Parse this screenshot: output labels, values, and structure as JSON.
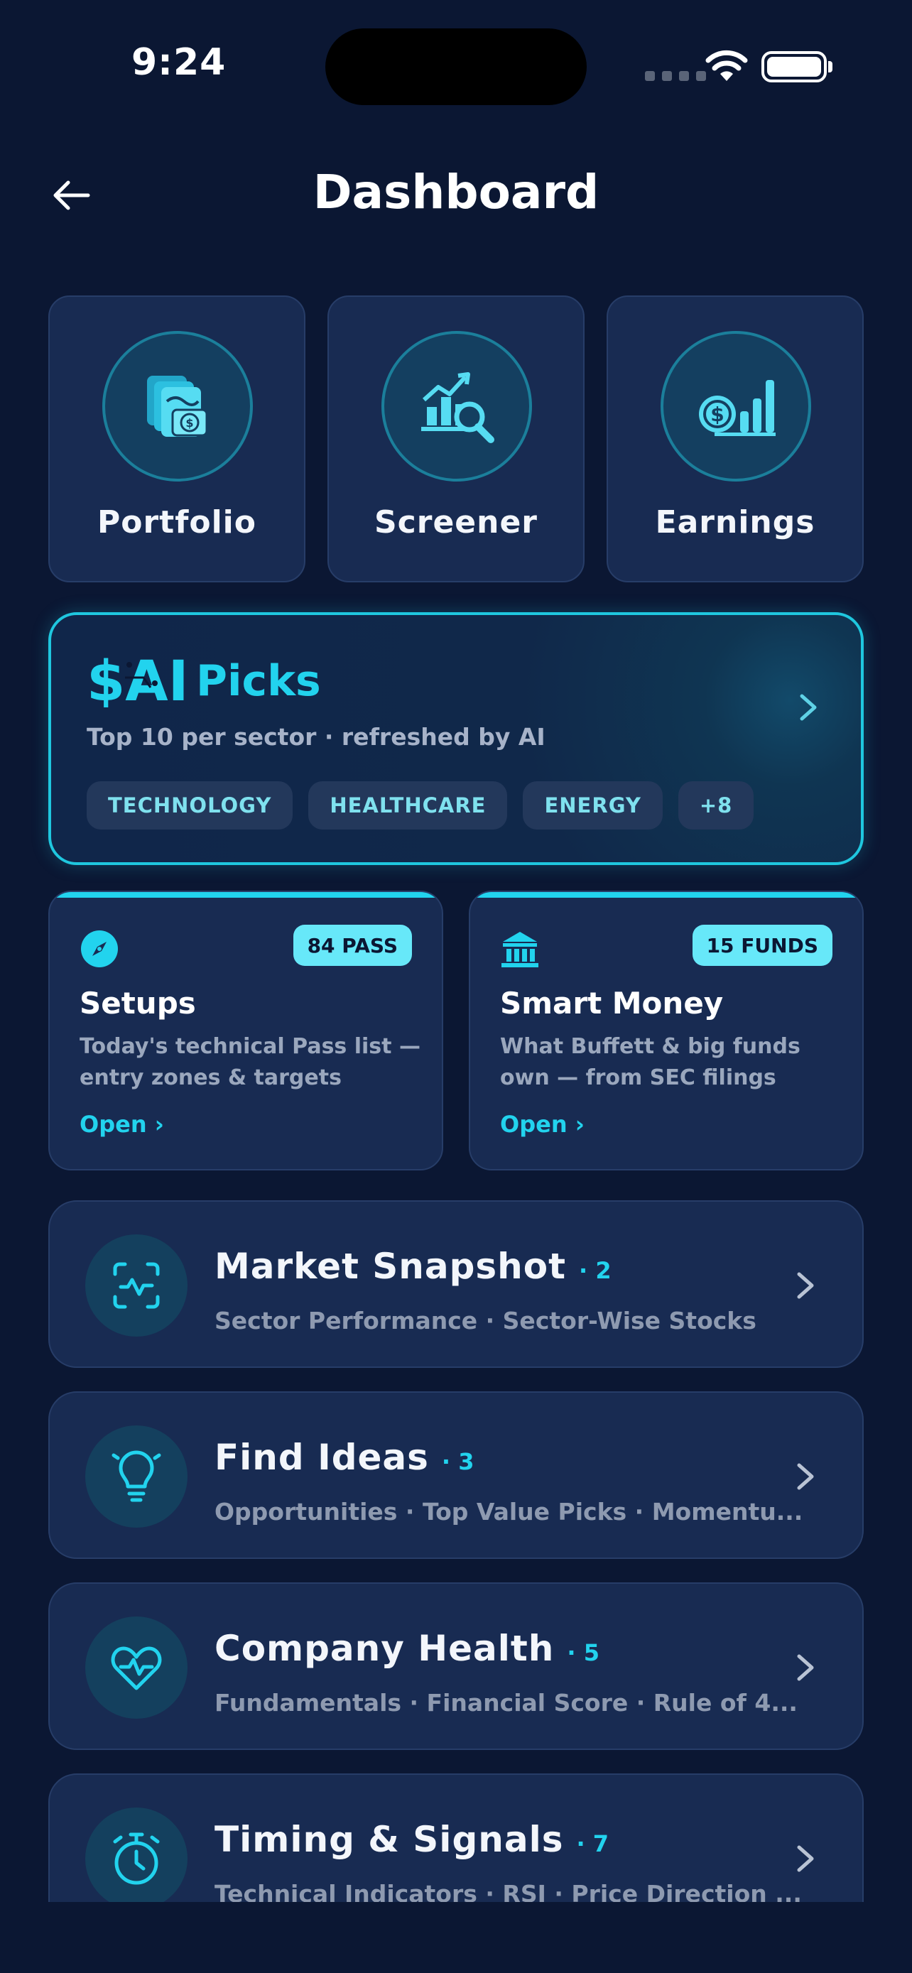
{
  "status_bar": {
    "time": "9:24"
  },
  "header": {
    "title": "Dashboard"
  },
  "tiles": [
    {
      "label": "Portfolio",
      "icon": "portfolio-cash-icon"
    },
    {
      "label": "Screener",
      "icon": "chart-search-icon"
    },
    {
      "label": "Earnings",
      "icon": "coin-bars-icon"
    }
  ],
  "ai_picks": {
    "logo_text": "$AI",
    "title": "Picks",
    "subtitle": "Top 10 per sector · refreshed by AI",
    "chips": [
      "TECHNOLOGY",
      "HEALTHCARE",
      "ENERGY",
      "+8"
    ]
  },
  "cards": [
    {
      "title": "Setups",
      "badge": "84 PASS",
      "description": "Today's technical Pass list — entry zones & targets",
      "link": "Open ›",
      "icon": "compass-icon"
    },
    {
      "title": "Smart Money",
      "badge": "15 FUNDS",
      "description": "What Buffett & big funds own — from SEC filings",
      "link": "Open ›",
      "icon": "bank-icon"
    }
  ],
  "rows": [
    {
      "title": "Market Snapshot",
      "count": "· 2",
      "subtitle": "Sector Performance · Sector-Wise Stocks",
      "icon": "activity-scan-icon"
    },
    {
      "title": "Find Ideas",
      "count": "· 3",
      "subtitle": "Opportunities · Top Value Picks · Momentu...",
      "icon": "lightbulb-icon"
    },
    {
      "title": "Company Health",
      "count": "· 5",
      "subtitle": "Fundamentals · Financial Score · Rule of 4...",
      "icon": "heart-pulse-icon"
    },
    {
      "title": "Timing & Signals",
      "count": "· 7",
      "subtitle": "Technical Indicators · RSI · Price Direction ...",
      "icon": "stopwatch-icon"
    }
  ],
  "colors": {
    "background": "#0b1733",
    "card": "#182b52",
    "accent": "#22d3ee",
    "badge": "#67e8f9"
  }
}
